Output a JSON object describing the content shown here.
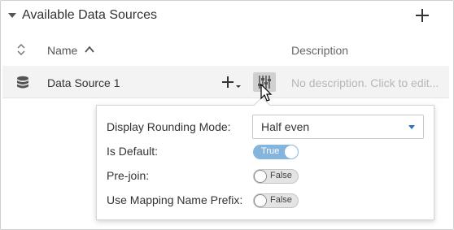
{
  "panel": {
    "title": "Available Data Sources",
    "columns": {
      "name": "Name",
      "description": "Description"
    }
  },
  "rows": [
    {
      "name": "Data Source 1",
      "description": "No description. Click to edit..."
    }
  ],
  "options": {
    "rounding": {
      "label": "Display Rounding Mode:",
      "value": "Half even"
    },
    "is_default": {
      "label": "Is Default:",
      "state": "True",
      "on": true
    },
    "pre_join": {
      "label": "Pre-join:",
      "state": "False",
      "on": false
    },
    "mapping_prefix": {
      "label": "Use Mapping Name Prefix:",
      "state": "False",
      "on": false
    }
  },
  "icons": {
    "collapse": "caret-down-icon",
    "add": "plus-icon",
    "sort": "sort-icon",
    "sort_asc": "chevron-up-icon",
    "database": "database-icon",
    "settings": "sliders-icon",
    "dropdown": "caret-down-icon"
  },
  "colors": {
    "toggle_on": "#85b5dc",
    "dropdown_caret": "#2e6fb5"
  }
}
